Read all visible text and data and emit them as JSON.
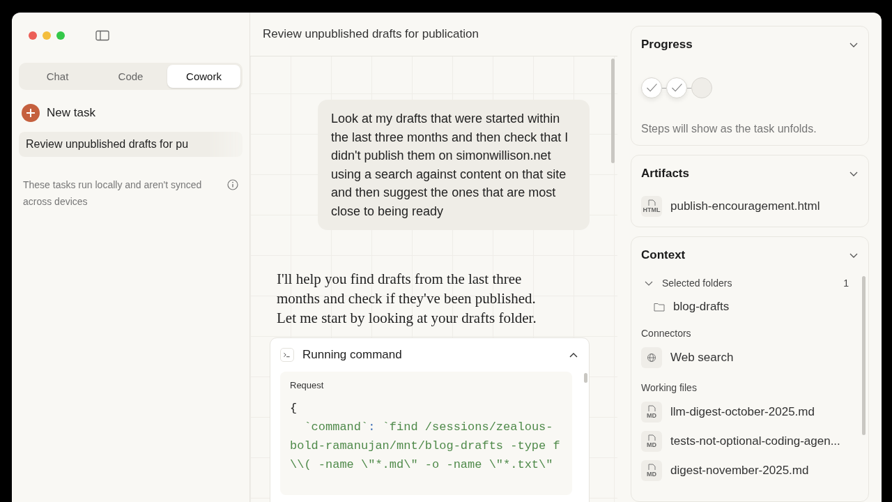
{
  "sidebar": {
    "tabs": [
      {
        "label": "Chat",
        "selected": false
      },
      {
        "label": "Code",
        "selected": false
      },
      {
        "label": "Cowork",
        "selected": true
      }
    ],
    "new_task": "New task",
    "tasks": [
      {
        "label": "Review unpublished drafts for pu",
        "selected": true
      }
    ],
    "note": "These tasks run locally and aren't synced across devices"
  },
  "main": {
    "title": "Review unpublished drafts for publication",
    "user_message": "Look at my drafts that were started within the last three months and then check that I didn't publish them on simonwillison.net using a search against content on that site and then suggest the ones that are most close to being ready",
    "assistant_message": "I'll help you find drafts from the last three months and check if they've been published. Let me start by looking at your drafts folder.",
    "tool": {
      "title": "Running command",
      "expanded": true,
      "request_label": "Request",
      "open": "{",
      "key": "`command`",
      "sep": ":",
      "value_lines": [
        "`find /sessions/zealous-",
        "bold-ramanujan/mnt/blog-drafts -type f",
        "\\\\( -name \\\"*.md\\\" -o -name \\\"*.txt\\\""
      ]
    }
  },
  "panel": {
    "progress": {
      "title": "Progress",
      "steps": [
        {
          "done": true
        },
        {
          "done": true
        },
        {
          "done": false
        }
      ],
      "hint": "Steps will show as the task unfolds."
    },
    "artifacts": {
      "title": "Artifacts",
      "items": [
        {
          "badge": "HTML",
          "name": "publish-encouragement.html"
        }
      ]
    },
    "context": {
      "title": "Context",
      "folders": {
        "label": "Selected folders",
        "count": "1",
        "expanded": true,
        "items": [
          "blog-drafts"
        ]
      },
      "connectors": {
        "label": "Connectors",
        "items": [
          "Web search"
        ]
      },
      "files": {
        "label": "Working files",
        "items": [
          {
            "badge": "MD",
            "name": "llm-digest-october-2025.md"
          },
          {
            "badge": "MD",
            "name": "tests-not-optional-coding-agen..."
          },
          {
            "badge": "MD",
            "name": "digest-november-2025.md"
          }
        ]
      }
    }
  }
}
